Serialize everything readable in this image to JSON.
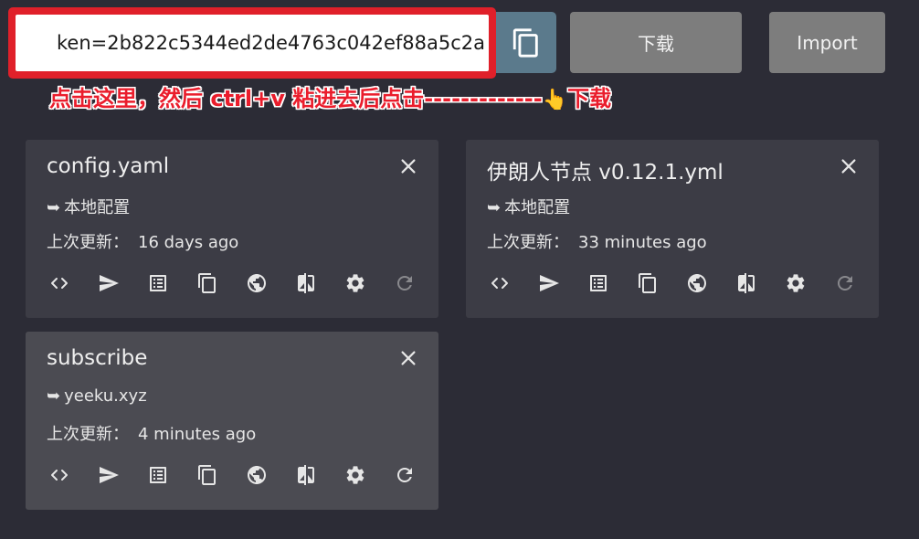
{
  "toolbar": {
    "url_value": "ken=2b822c5344ed2de4763c042ef88a5c2a",
    "download_label": "下载",
    "import_label": "Import",
    "hint_text": "点击这里，然后 ctrl+v 粘进去后点击-------------",
    "hint_hand": "👆",
    "hint_suffix": "下载"
  },
  "colors": {
    "background": "#2c2c36",
    "card": "#3c3c45",
    "card_active": "#4b4b52",
    "highlight_red": "#e0202a",
    "paste_button": "#5b7a8c",
    "button": "#7d7d7d"
  },
  "updated_label": "上次更新：",
  "cards": [
    {
      "title": "config.yaml",
      "source": "本地配置",
      "updated": "16 days ago",
      "refresh_enabled": false
    },
    {
      "title": "伊朗人节点 v0.12.1.yml",
      "source": "本地配置",
      "updated": "33 minutes ago",
      "refresh_enabled": false
    },
    {
      "title": "subscribe",
      "source": "yeeku.xyz",
      "updated": "4 minutes ago",
      "refresh_enabled": true
    }
  ],
  "source_arrow": "➥",
  "action_icons": [
    "code-icon",
    "send-icon",
    "list-icon",
    "copy-icon",
    "globe-icon",
    "compare-icon",
    "gear-icon",
    "refresh-icon"
  ]
}
